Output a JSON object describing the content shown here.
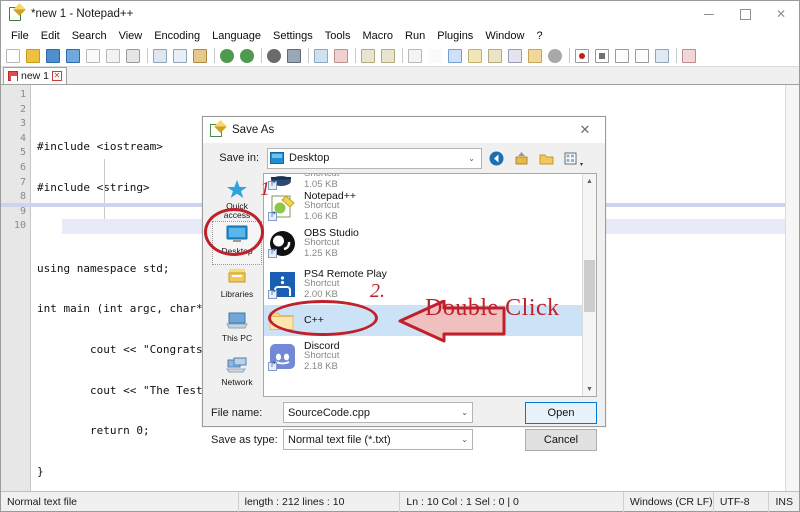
{
  "app": {
    "title": "*new 1 - Notepad++",
    "title_icon": "notepad-plus-plus-icon"
  },
  "window_controls": {
    "minimize": "–",
    "maximize": "□",
    "close": "✕"
  },
  "menubar": {
    "items": [
      "File",
      "Edit",
      "Search",
      "View",
      "Encoding",
      "Language",
      "Settings",
      "Tools",
      "Macro",
      "Run",
      "Plugins",
      "Window",
      "?"
    ]
  },
  "toolbar": {
    "icons": [
      "new-file-icon",
      "open-file-icon",
      "save-icon",
      "save-all-icon",
      "close-file-icon",
      "close-all-icon",
      "print-icon",
      "cut-icon",
      "copy-icon",
      "paste-icon",
      "undo-icon",
      "redo-icon",
      "find-icon",
      "replace-icon",
      "zoom-in-icon",
      "zoom-out-icon",
      "sync-vertical-icon",
      "sync-horizontal-icon",
      "word-wrap-icon",
      "show-all-chars-icon",
      "indent-guide-icon",
      "ui-user-defined-dialog-icon",
      "doc-map-icon",
      "function-list-icon",
      "folder-as-workspace-icon",
      "monitoring-icon",
      "macro-record-icon",
      "macro-stop-icon",
      "macro-play-icon",
      "macro-playback-multiple-icon",
      "macro-save-icon",
      "run-icon"
    ]
  },
  "tabs": [
    {
      "label": "new 1",
      "modified": true,
      "close_glyph": "✕"
    }
  ],
  "editor": {
    "line_numbers": [
      "1",
      "2",
      "3",
      "4",
      "5",
      "6",
      "7",
      "8",
      "9",
      "10"
    ],
    "lines": [
      "#include <iostream>",
      "#include <string>",
      "",
      "using namespace std;",
      "int main (int argc, char**",
      "        cout << \"Congrats ",
      "        cout << \"The Test ",
      "        return 0;",
      "}",
      ""
    ],
    "caret_line": 10
  },
  "statusbar": {
    "doc_type": "Normal text file",
    "length_lines": "length : 212   lines : 10",
    "position": "Ln : 10    Col : 1    Sel : 0 | 0",
    "eol": "Windows (CR LF)",
    "encoding": "UTF-8",
    "insert_mode": "INS"
  },
  "dialog": {
    "title": "Save As",
    "title_icon": "notepad-plus-plus-icon",
    "close_glyph": "✕",
    "save_in": {
      "label": "Save in:",
      "value": "Desktop",
      "icon": "desktop-folder-icon",
      "caret": "⌄"
    },
    "nav_buttons": [
      "back-icon",
      "up-one-level-icon",
      "new-folder-icon",
      "views-icon"
    ],
    "views_caret": "▾",
    "places": [
      {
        "label": "Quick access",
        "icon": "star-icon",
        "selected": false
      },
      {
        "label": "Desktop",
        "icon": "desktop-icon",
        "selected": true
      },
      {
        "label": "Libraries",
        "icon": "libraries-icon",
        "selected": false
      },
      {
        "label": "This PC",
        "icon": "this-pc-icon",
        "selected": false
      },
      {
        "label": "Network",
        "icon": "network-icon",
        "selected": false
      }
    ],
    "files": [
      {
        "name": "",
        "type": "Shortcut",
        "size": "1.05 KB",
        "icon": "cauldron-shortcut-icon",
        "selected": false,
        "clipped": true
      },
      {
        "name": "Notepad++",
        "type": "Shortcut",
        "size": "1.06 KB",
        "icon": "notepad-plus-plus-shortcut-icon",
        "selected": false
      },
      {
        "name": "OBS Studio",
        "type": "Shortcut",
        "size": "1.25 KB",
        "icon": "obs-studio-shortcut-icon",
        "selected": false
      },
      {
        "name": "PS4 Remote Play",
        "type": "Shortcut",
        "size": "2.00 KB",
        "icon": "ps4-remote-play-shortcut-icon",
        "selected": false
      },
      {
        "name": "C++",
        "type": "",
        "size": "",
        "icon": "folder-icon",
        "selected": true
      },
      {
        "name": "Discord",
        "type": "Shortcut",
        "size": "2.18 KB",
        "icon": "discord-shortcut-icon",
        "selected": false
      }
    ],
    "scroll": {
      "up_glyph": "▲",
      "down_glyph": "▼"
    },
    "file_name": {
      "label": "File name:",
      "value": "SourceCode.cpp",
      "caret": "⌄"
    },
    "save_as_type": {
      "label": "Save as type:",
      "value": "Normal text file (*.txt)",
      "caret": "⌄"
    },
    "buttons": {
      "open": "Open",
      "cancel": "Cancel"
    }
  },
  "annotations": {
    "step1": "1",
    "step2": "2.",
    "double_click": "Double Click",
    "accent_color": "#c0202a"
  }
}
